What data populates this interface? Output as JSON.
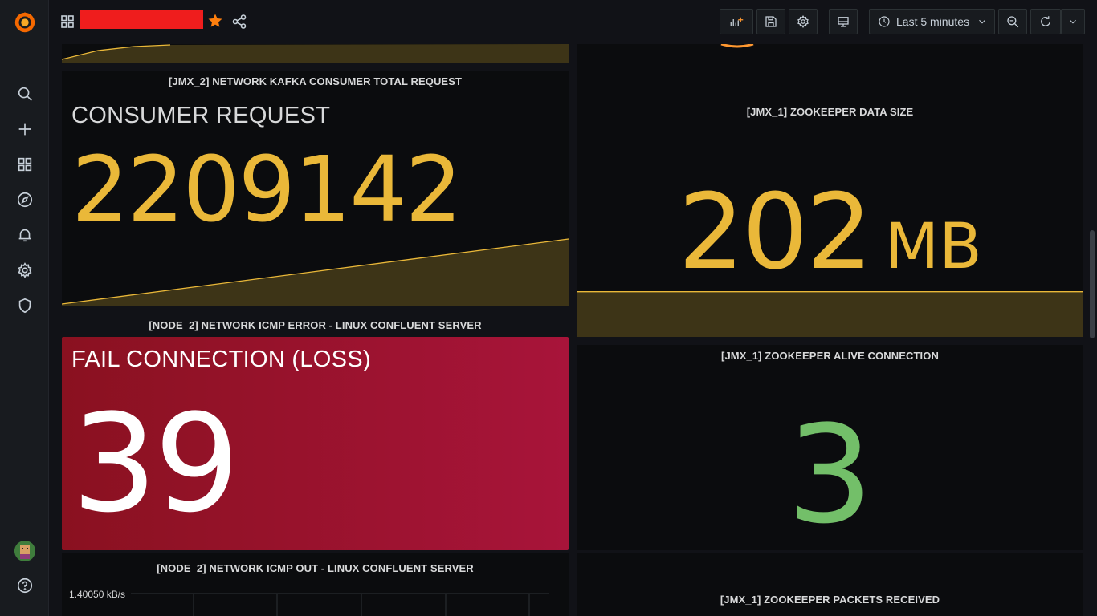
{
  "sidebar": {
    "items": [
      "grafana-logo",
      "search-icon",
      "plus-icon",
      "dashboards-icon",
      "explore-icon",
      "alerting-icon",
      "configuration-icon",
      "shield-icon",
      "help-icon"
    ]
  },
  "topbar": {
    "time_range": "Last 5 minutes"
  },
  "panels": {
    "consumer_title": "[JMX_2] NETWORK KAFKA CONSUMER TOTAL REQUEST",
    "consumer_label": "CONSUMER REQUEST",
    "consumer_value": "2209142",
    "zk_data_title": "[JMX_1] ZOOKEEPER DATA SIZE",
    "zk_data_value": "202",
    "zk_data_unit": "MB",
    "icmp_error_title": "[NODE_2] NETWORK ICMP ERROR - LINUX CONFLUENT SERVER",
    "icmp_error_label": "FAIL CONNECTION (LOSS)",
    "icmp_error_value": "39",
    "zk_alive_title": "[JMX_1] ZOOKEEPER ALIVE CONNECTION",
    "zk_alive_value": "3",
    "icmp_out_title": "[NODE_2] NETWORK ICMP OUT - LINUX CONFLUENT SERVER",
    "icmp_out_axis": "1.40050 kB/s",
    "zk_packets_title": "[JMX_1] ZOOKEEPER PACKETS RECEIVED"
  },
  "colors": {
    "yellow": "#eab839",
    "red_bg": "#a0142c",
    "green": "#73bf69",
    "orange": "#ff7f0e"
  }
}
